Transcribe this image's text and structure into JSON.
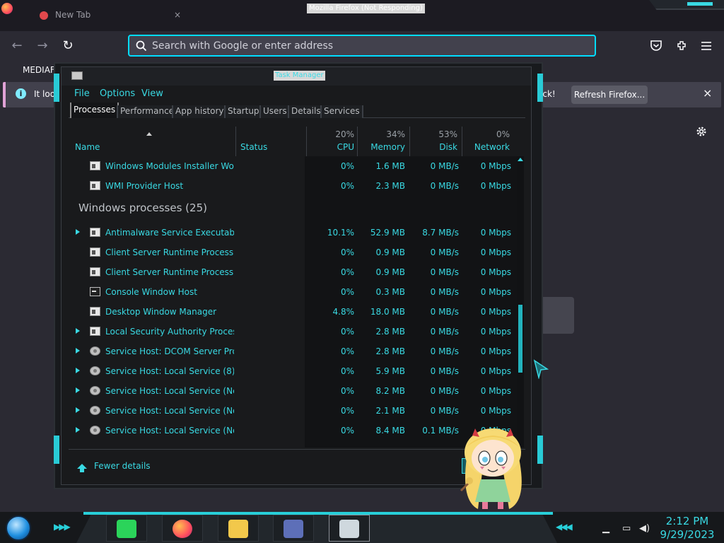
{
  "firefox": {
    "window_title": "Mozilla Firefox (Not Responding)",
    "tab_label": "New Tab",
    "tab_close": "×",
    "search_placeholder": "Search with Google or enter address",
    "bookmark": "MEDIAFIR",
    "notification_left": "It look",
    "notification_right": "ack!",
    "refresh_label": "Refresh Firefox...",
    "close_glyph": "×",
    "nav": {
      "back": "←",
      "forward": "→",
      "reload": "↻"
    }
  },
  "task_manager": {
    "title": "Task Manager",
    "menu": [
      "File",
      "Options",
      "View"
    ],
    "tabs": [
      "Processes",
      "Performance",
      "App history",
      "Startup",
      "Users",
      "Details",
      "Services"
    ],
    "active_tab": "Processes",
    "columns": {
      "name": "Name",
      "status": "Status",
      "cpu": {
        "label": "CPU",
        "pct": "20%"
      },
      "memory": {
        "label": "Memory",
        "pct": "34%"
      },
      "disk": {
        "label": "Disk",
        "pct": "53%"
      },
      "network": {
        "label": "Network",
        "pct": "0%"
      }
    },
    "rows": [
      {
        "name": "Windows Modules Installer Wor...",
        "cpu": "0%",
        "mem": "1.6 MB",
        "disk": "0 MB/s",
        "net": "0 Mbps",
        "expand": false,
        "icon": "window"
      },
      {
        "name": "WMI Provider Host",
        "cpu": "0%",
        "mem": "2.3 MB",
        "disk": "0 MB/s",
        "net": "0 Mbps",
        "expand": false,
        "icon": "wmi"
      }
    ],
    "group_label": "Windows processes (25)",
    "group_rows": [
      {
        "name": "Antimalware Service Executable",
        "cpu": "10.1%",
        "mem": "52.9 MB",
        "disk": "8.7 MB/s",
        "net": "0 Mbps",
        "expand": true,
        "icon": "window"
      },
      {
        "name": "Client Server Runtime Process",
        "cpu": "0%",
        "mem": "0.9 MB",
        "disk": "0 MB/s",
        "net": "0 Mbps",
        "expand": false,
        "icon": "window"
      },
      {
        "name": "Client Server Runtime Process",
        "cpu": "0%",
        "mem": "0.9 MB",
        "disk": "0 MB/s",
        "net": "0 Mbps",
        "expand": false,
        "icon": "window"
      },
      {
        "name": "Console Window Host",
        "cpu": "0%",
        "mem": "0.3 MB",
        "disk": "0 MB/s",
        "net": "0 Mbps",
        "expand": false,
        "icon": "console"
      },
      {
        "name": "Desktop Window Manager",
        "cpu": "4.8%",
        "mem": "18.0 MB",
        "disk": "0 MB/s",
        "net": "0 Mbps",
        "expand": false,
        "icon": "window"
      },
      {
        "name": "Local Security Authority Process",
        "cpu": "0%",
        "mem": "2.8 MB",
        "disk": "0 MB/s",
        "net": "0 Mbps",
        "expand": true,
        "icon": "window"
      },
      {
        "name": "Service Host: DCOM Server Proc...",
        "cpu": "0%",
        "mem": "2.8 MB",
        "disk": "0 MB/s",
        "net": "0 Mbps",
        "expand": true,
        "icon": "gear"
      },
      {
        "name": "Service Host: Local Service (8)",
        "cpu": "0%",
        "mem": "5.9 MB",
        "disk": "0 MB/s",
        "net": "0 Mbps",
        "expand": true,
        "icon": "gear"
      },
      {
        "name": "Service Host: Local Service (Net...",
        "cpu": "0%",
        "mem": "8.2 MB",
        "disk": "0 MB/s",
        "net": "0 Mbps",
        "expand": true,
        "icon": "gear"
      },
      {
        "name": "Service Host: Local Service (No l...",
        "cpu": "0%",
        "mem": "2.1 MB",
        "disk": "0 MB/s",
        "net": "0 Mbps",
        "expand": true,
        "icon": "gear"
      },
      {
        "name": "Service Host: Local Service (No ...",
        "cpu": "0%",
        "mem": "8.4 MB",
        "disk": "0.1 MB/s",
        "net": "0 Mbps",
        "expand": true,
        "icon": "gear"
      }
    ],
    "fewer_details": "Fewer details"
  },
  "taskbar": {
    "apps": [
      "notes-app",
      "firefox",
      "file-explorer",
      "control-panel",
      "task-manager"
    ],
    "time": "2:12 PM",
    "date": "9/29/2023"
  },
  "colors": {
    "accent": "#39d9e3",
    "background": "#2b2a33",
    "url_focus": "#00ddff"
  }
}
